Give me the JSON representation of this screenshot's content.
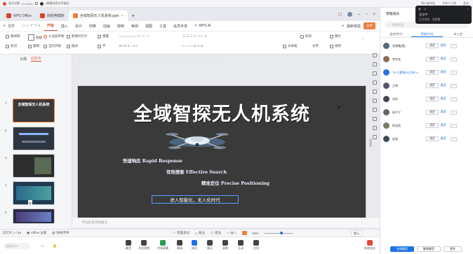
{
  "topbar": {
    "meeting_status": "会议详情",
    "timer": "01:18:01",
    "notice": "4随播消息文件缓存",
    "items": [
      "演示者布局",
      "主持人工具",
      "会议"
    ]
  },
  "wps": {
    "tabs": [
      {
        "label": "WPS Office",
        "color": "#d9412c"
      },
      {
        "label": "找稻壳模板",
        "color": "#d9412c"
      },
      {
        "label": "全域智探无人机系统.pptx",
        "color": "#f07c3e"
      }
    ],
    "menu": [
      "文件",
      "开始",
      "插入",
      "设计",
      "切换",
      "动画",
      "放映",
      "审阅",
      "视图",
      "工具",
      "会员专享",
      "WPS AI"
    ],
    "active_menu": "开始",
    "sync_label": "最新体验",
    "share_label": "分享"
  },
  "ribbon": {
    "row1": [
      "格式刷",
      "粘贴",
      "从当前开始",
      "新建幻灯片",
      "版式",
      "重置",
      "形状",
      "图片",
      "排列"
    ],
    "row2": [
      "剪切",
      "复制",
      "当页开始",
      "节",
      "文本框",
      "文字"
    ]
  },
  "left_panel": {
    "tabs": [
      "大纲",
      "幻灯片"
    ],
    "active_tab": "幻灯片",
    "slide_numbers": [
      "1",
      "2",
      "3",
      "4",
      "5"
    ],
    "add_label": "+"
  },
  "slide": {
    "title": "全域智探无人机系统",
    "bullet1": "快速响应 Rapid Response",
    "bullet2": "有效搜索 Effective Search",
    "bullet3": "精准定位 Precise Positioning",
    "tagline": "进入智能化，无人化时代"
  },
  "notes_placeholder": "单击此处添加备注",
  "statusbar": {
    "slide_counter": "幻灯片 1 / 48",
    "theme": "Office 主题",
    "font_missing": "缺失字体",
    "smart_beautify": "智能美化",
    "notes": "备注",
    "comments": "批注",
    "zoom": "62%",
    "hint": "提示"
  },
  "taskbar": {
    "input_placeholder": "说点什么...",
    "items": [
      "静音",
      "开启视频",
      "共享屏幕",
      "邀请",
      "成员",
      "聊天",
      "录制",
      "互动",
      "应用",
      "结束会议"
    ]
  },
  "right_panel": {
    "title": "管理成员",
    "search_placeholder": "搜索成员",
    "tabs": [
      "会议中(7)",
      "等候中(0)",
      "未入会"
    ],
    "members": [
      {
        "name": "张晓晨(我)",
        "action": "静音"
      },
      {
        "name": "李文宏",
        "action": "静音"
      },
      {
        "name": "TB·主题演示(主持人)",
        "action": "静音"
      },
      {
        "name": "王明",
        "action": "静音"
      },
      {
        "name": "刘洋",
        "action": "静音"
      },
      {
        "name": "周子宁",
        "action": "静音"
      },
      {
        "name": "陈浩然",
        "action": "静音"
      },
      {
        "name": "赵丽",
        "action": "静音"
      }
    ],
    "member_role": "成员",
    "more_label": "···",
    "bottom_buttons": [
      "全体静音",
      "解除静音",
      "更多"
    ]
  },
  "meeting_popup": {
    "title": "会议中",
    "subtitle": "正在讲话：张晓晨"
  },
  "colors": {
    "accent": "#d9512c",
    "blue": "#1e74e6",
    "slide_bg": "#3a3a3a"
  }
}
